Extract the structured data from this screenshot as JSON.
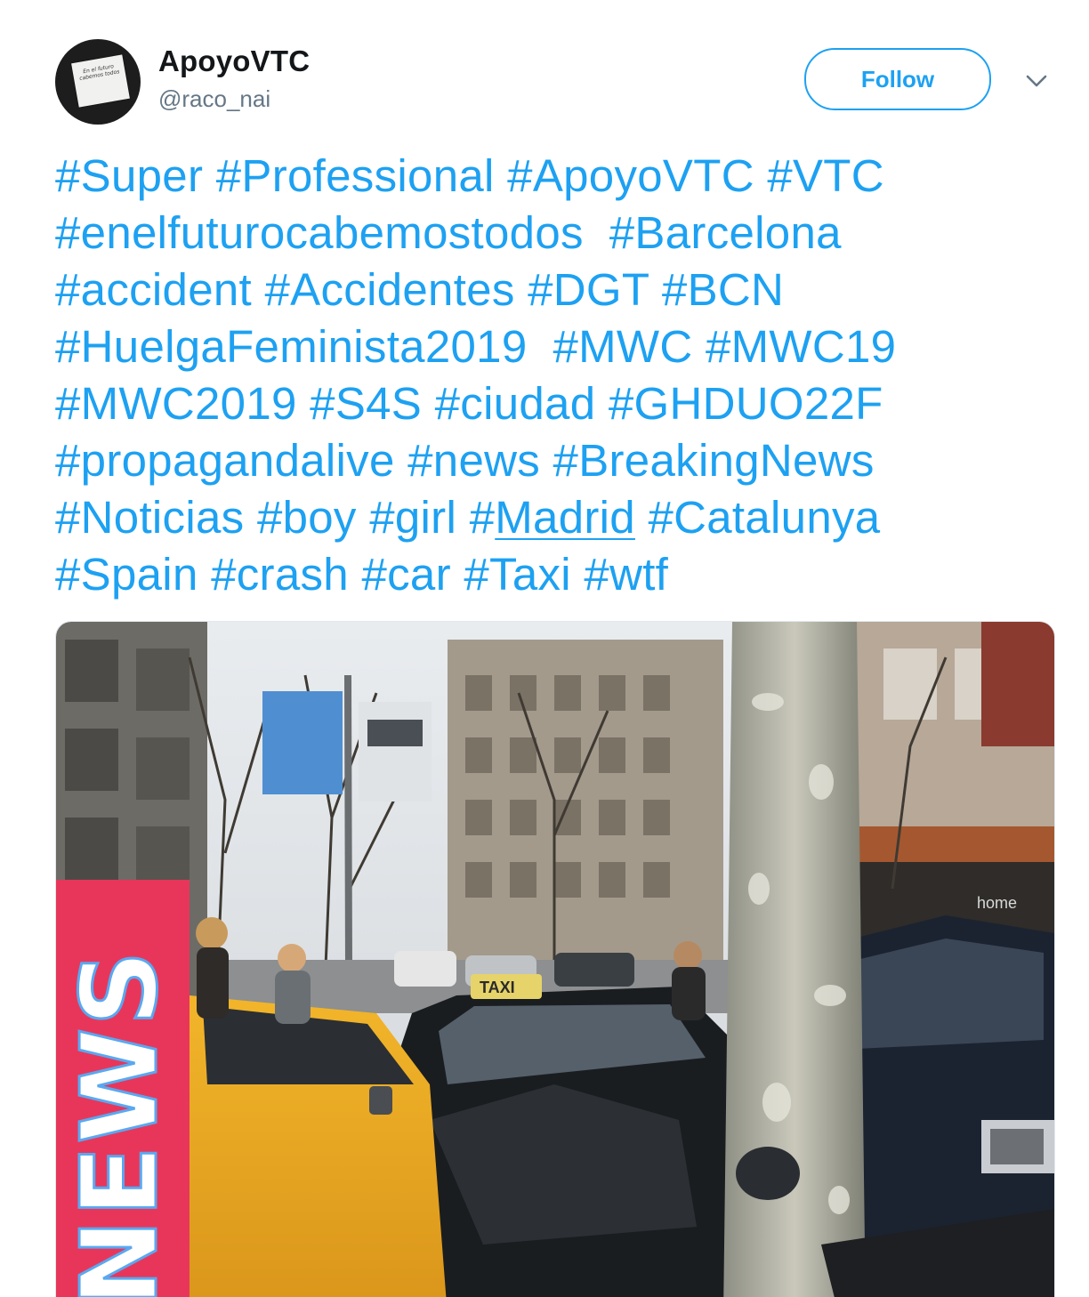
{
  "user": {
    "display_name": "ApoyoVTC",
    "handle": "@raco_nai",
    "avatar_note_text": "En el futuro cabemos todos"
  },
  "actions": {
    "follow_label": "Follow",
    "more_icon": "chevron-down-icon"
  },
  "tweet": {
    "lines": [
      [
        "#Super",
        " ",
        "#Professional",
        " ",
        "#ApoyoVTC",
        " ",
        "#VTC"
      ],
      [
        "#enelfuturocabemostodos",
        "  ",
        "#Barcelona"
      ],
      [
        "#accident",
        " ",
        "#Accidentes",
        " ",
        "#DGT",
        " ",
        "#BCN"
      ],
      [
        "#HuelgaFeminista2019",
        "  ",
        "#MWC",
        " ",
        "#MWC19"
      ],
      [
        "#MWC2019",
        " ",
        "#S4S",
        " ",
        "#ciudad",
        " ",
        "#GHDUO22F"
      ],
      [
        "#propagandalive",
        " ",
        "#news",
        " ",
        "#BreakingNews"
      ],
      [
        "#Noticias",
        " ",
        "#boy",
        " ",
        "#girl",
        " ",
        "#",
        "Madrid",
        " ",
        "#Catalunya"
      ],
      [
        "#Spain",
        " ",
        "#crash",
        " ",
        "#car",
        " ",
        "#Taxi",
        " ",
        "#wtf"
      ]
    ],
    "line1": {
      "h1": "#Super",
      "h2": "#Professional",
      "h3": "#ApoyoVTC",
      "h4": "#VTC"
    },
    "line2": {
      "h1": "#enelfuturocabemostodos",
      "h2": "#Barcelona"
    },
    "line3": {
      "h1": "#accident",
      "h2": "#Accidentes",
      "h3": "#DGT",
      "h4": "#BCN"
    },
    "line4": {
      "h1": "#HuelgaFeminista2019",
      "h2": "#MWC",
      "h3": "#MWC19"
    },
    "line5": {
      "h1": "#MWC2019",
      "h2": "#S4S",
      "h3": "#ciudad",
      "h4": "#GHDUO22F"
    },
    "line6": {
      "h1": "#propagandalive",
      "h2": "#news",
      "h3": "#BreakingNews"
    },
    "line7": {
      "h1": "#Noticias",
      "h2": "#boy",
      "h3": "#girl",
      "h4_hash": "#",
      "h4_word": "Madrid",
      "h5": "#Catalunya"
    },
    "line8": {
      "h1": "#Spain",
      "h2": "#crash",
      "h3": "#car",
      "h4": "#Taxi",
      "h5": "#wtf"
    }
  },
  "media": {
    "overlay_text": "NEWS",
    "taxi_sign": "TAXI",
    "storefront_sign": "home"
  },
  "colors": {
    "link": "#1da1f2",
    "name": "#14171a",
    "handle": "#657786",
    "news_banner": "#e8365a"
  }
}
